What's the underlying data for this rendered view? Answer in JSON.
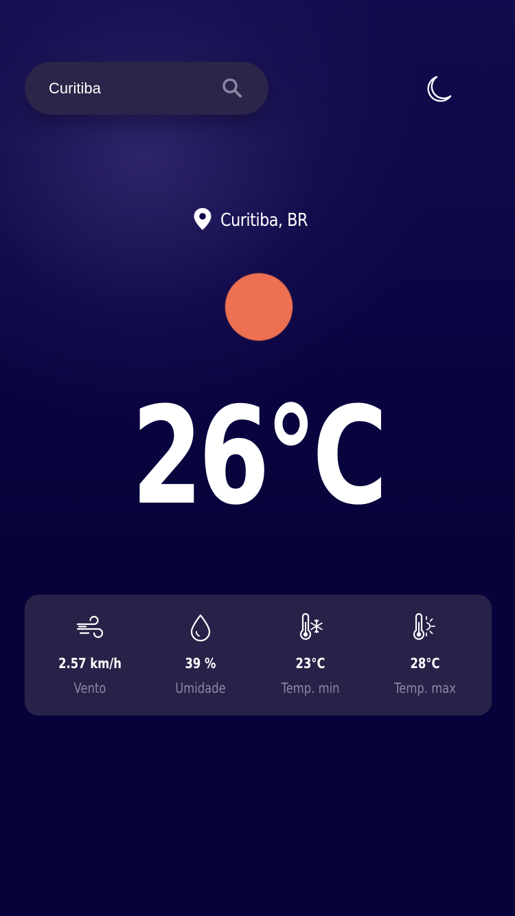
{
  "search": {
    "value": "Curitiba",
    "icon": "search-icon"
  },
  "theme_toggle": {
    "icon": "moon-icon"
  },
  "location": {
    "icon": "map-pin-icon",
    "text": "Curitiba, BR"
  },
  "weather": {
    "condition_icon": "sun-icon",
    "temperature": "26°C"
  },
  "stats": [
    {
      "icon": "wind-icon",
      "value": "2.57 km/h",
      "label": "Vento"
    },
    {
      "icon": "droplet-icon",
      "value": "39 %",
      "label": "Umidade"
    },
    {
      "icon": "thermometer-snowflake-icon",
      "value": "23°C",
      "label": "Temp. min"
    },
    {
      "icon": "thermometer-sun-icon",
      "value": "28°C",
      "label": "Temp. max"
    }
  ],
  "colors": {
    "background": "#07033a",
    "card": "#282248",
    "search_bar": "#2b2649",
    "sun": "#ec7051",
    "label": "#8c88a6",
    "text": "#ffffff"
  }
}
